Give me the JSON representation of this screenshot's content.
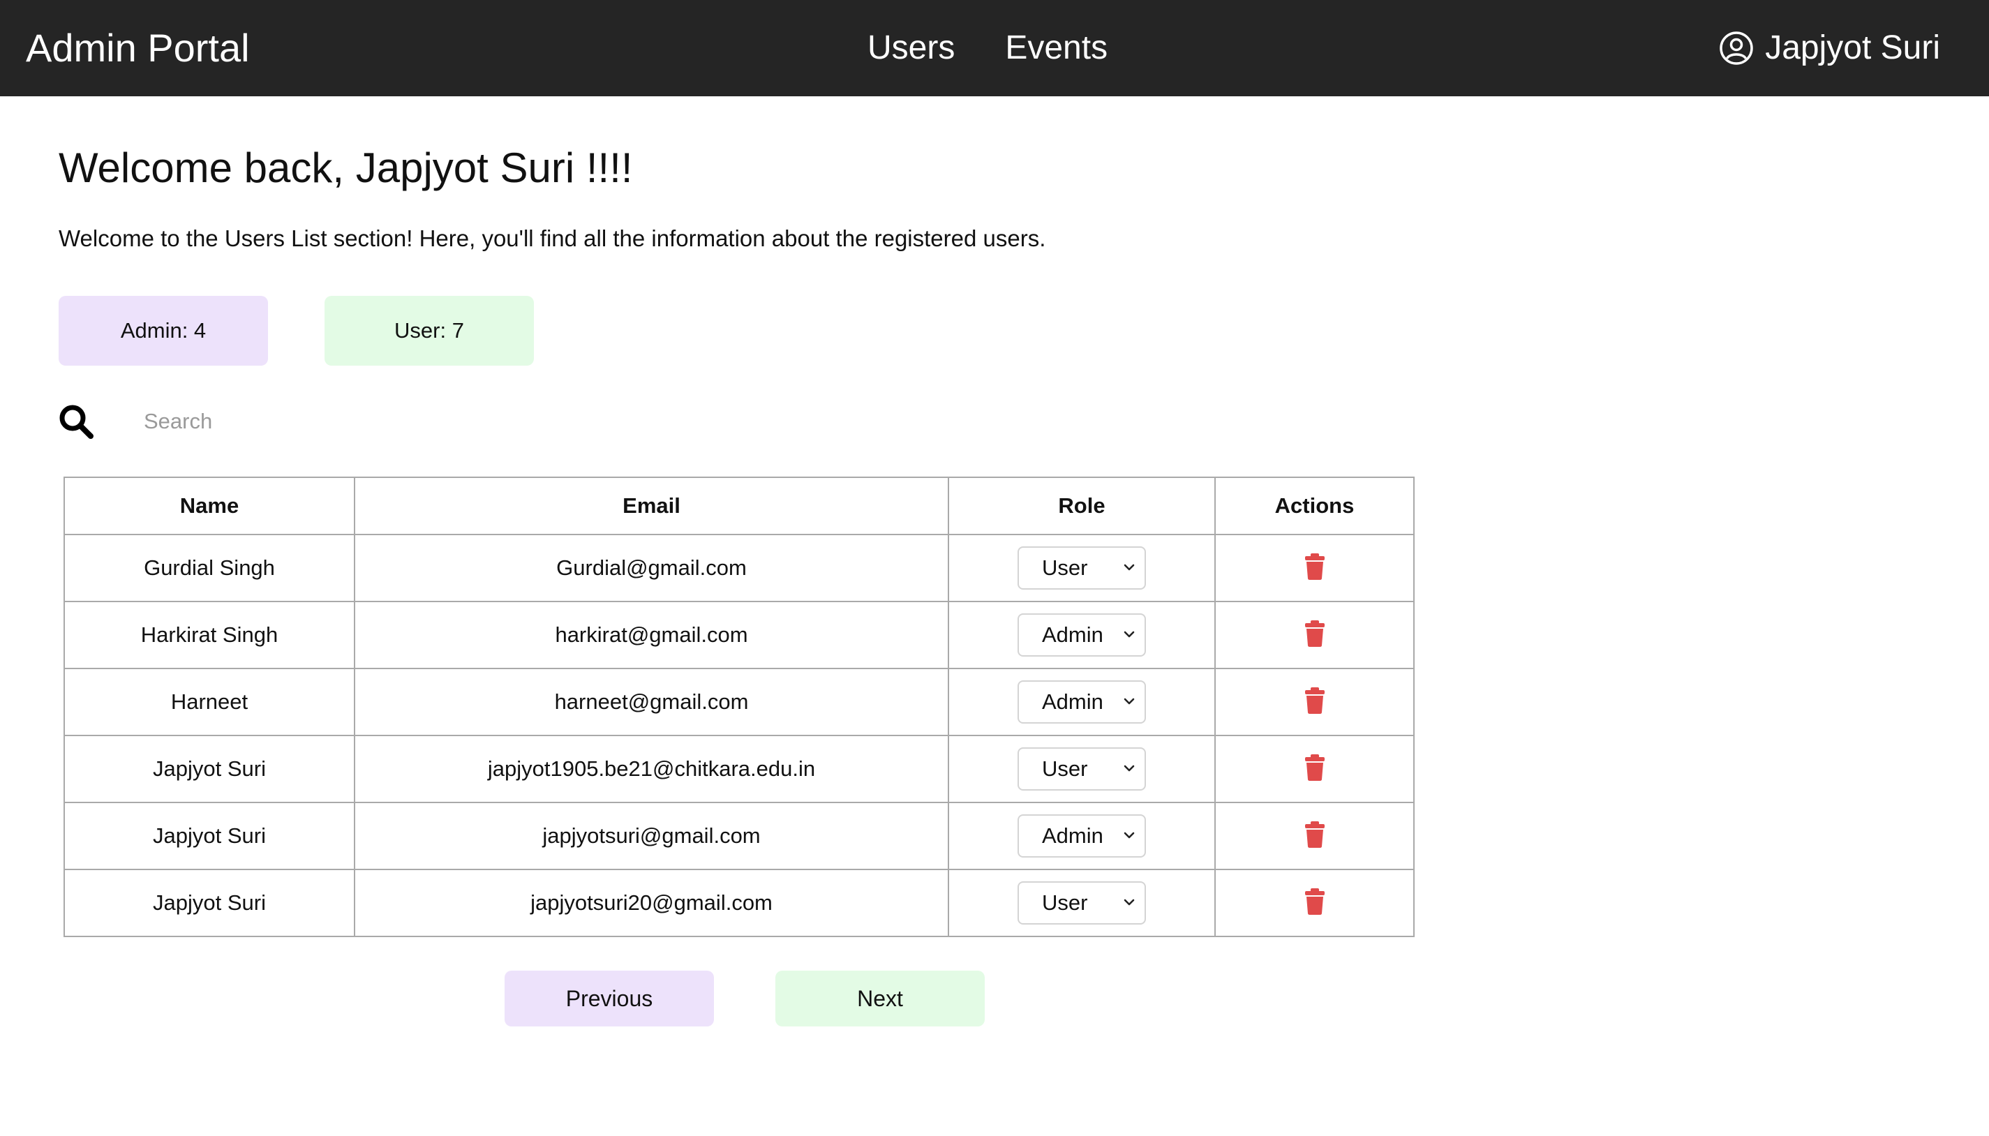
{
  "navbar": {
    "brand": "Admin Portal",
    "links": [
      "Users",
      "Events"
    ],
    "user_name": "Japjyot Suri",
    "user_icon": "user-circle-icon"
  },
  "welcome": {
    "title": "Welcome back, Japjyot Suri !!!!",
    "text": "Welcome to the Users List section! Here, you'll find all the information about the registered users."
  },
  "stats": {
    "admin": "Admin: 4",
    "user": "User: 7"
  },
  "search": {
    "icon": "search-icon",
    "placeholder": "Search"
  },
  "table": {
    "headers": [
      "Name",
      "Email",
      "Role",
      "Actions"
    ],
    "rows": [
      {
        "name": "Gurdial Singh",
        "email": "Gurdial@gmail.com",
        "role": "User"
      },
      {
        "name": "Harkirat Singh",
        "email": "harkirat@gmail.com",
        "role": "Admin"
      },
      {
        "name": "Harneet",
        "email": "harneet@gmail.com",
        "role": "Admin"
      },
      {
        "name": "Japjyot Suri",
        "email": "japjyot1905.be21@chitkara.edu.in",
        "role": "User"
      },
      {
        "name": "Japjyot Suri",
        "email": "japjyotsuri@gmail.com",
        "role": "Admin"
      },
      {
        "name": "Japjyot Suri",
        "email": "japjyotsuri20@gmail.com",
        "role": "User"
      }
    ],
    "delete_icon": "trash-icon",
    "delete_color": "#e04a4a"
  },
  "pagination": {
    "previous": "Previous",
    "next": "Next"
  },
  "colors": {
    "navbar_bg": "#252525",
    "admin_badge_bg": "#ede2fb",
    "user_badge_bg": "#e3fbe5"
  }
}
